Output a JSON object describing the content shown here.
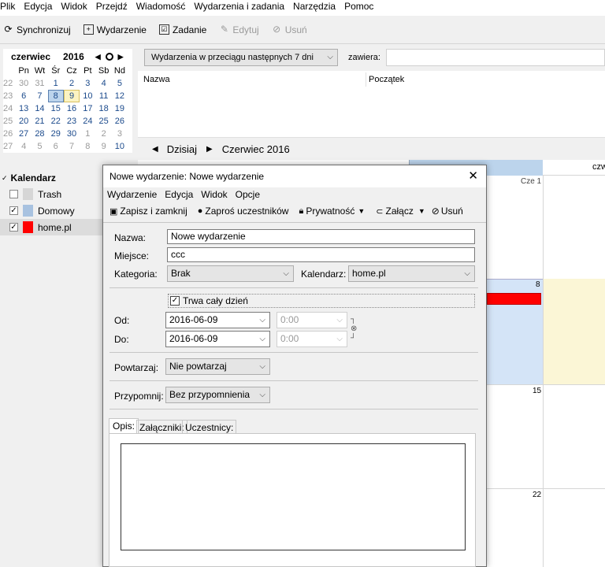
{
  "menubar": {
    "items": [
      "Plik",
      "Edycja",
      "Widok",
      "Przejdź",
      "Wiadomość",
      "Wydarzenia i zadania",
      "Narzędzia",
      "Pomoc"
    ]
  },
  "toolbar": {
    "sync": "Synchronizuj",
    "event": "Wydarzenie",
    "task": "Zadanie",
    "edit": "Edytuj",
    "delete": "Usuń"
  },
  "minical": {
    "month": "czerwiec",
    "year": "2016",
    "daynames": [
      "Pn",
      "Wt",
      "Śr",
      "Cz",
      "Pt",
      "Sb",
      "Nd"
    ],
    "weeks": [
      {
        "wk": "22",
        "days": [
          "30",
          "31",
          "1",
          "2",
          "3",
          "4",
          "5"
        ]
      },
      {
        "wk": "23",
        "days": [
          "6",
          "7",
          "8",
          "9",
          "10",
          "11",
          "12"
        ]
      },
      {
        "wk": "24",
        "days": [
          "13",
          "14",
          "15",
          "16",
          "17",
          "18",
          "19"
        ]
      },
      {
        "wk": "25",
        "days": [
          "20",
          "21",
          "22",
          "23",
          "24",
          "25",
          "26"
        ]
      },
      {
        "wk": "26",
        "days": [
          "27",
          "28",
          "29",
          "30",
          "1",
          "2",
          "3"
        ]
      },
      {
        "wk": "27",
        "days": [
          "4",
          "5",
          "6",
          "7",
          "8",
          "9",
          "10"
        ]
      }
    ]
  },
  "calendars": {
    "header": "Kalendarz",
    "items": [
      {
        "name": "Trash",
        "checked": false,
        "color": "#d6d6d6"
      },
      {
        "name": "Domowy",
        "checked": true,
        "color": "#a8c2e0"
      },
      {
        "name": "home.pl",
        "checked": true,
        "color": "#ff0000"
      }
    ]
  },
  "search": {
    "filter": "Wydarzenia w przeciągu następnych 7 dni",
    "contains_label": "zawiera:",
    "col_name": "Nazwa",
    "col_start": "Początek"
  },
  "nav": {
    "today": "Dzisiaj",
    "period": "Czerwiec 2016"
  },
  "week": {
    "col_label": "czw",
    "cells": {
      "cze1": "Cze 1",
      "d8": "8",
      "d15": "15",
      "d22": "22"
    }
  },
  "dialog": {
    "title": "Nowe wydarzenie: Nowe wydarzenie",
    "menu": [
      "Wydarzenie",
      "Edycja",
      "Widok",
      "Opcje"
    ],
    "toolbar": {
      "save_close": "Zapisz i zamknij",
      "invite": "Zaproś uczestników",
      "privacy": "Prywatność",
      "attach": "Załącz",
      "delete": "Usuń"
    },
    "labels": {
      "name": "Nazwa:",
      "place": "Miejsce:",
      "category": "Kategoria:",
      "calendar": "Kalendarz:",
      "allday": "Trwa cały dzień",
      "from": "Od:",
      "to": "Do:",
      "repeat": "Powtarzaj:",
      "remind": "Przypomnij:"
    },
    "values": {
      "name": "Nowe wydarzenie",
      "place": "ccc",
      "category": "Brak",
      "calendar": "home.pl",
      "from_date": "2016-06-09",
      "from_time": "0:00",
      "to_date": "2016-06-09",
      "to_time": "0:00",
      "repeat": "Nie powtarzaj",
      "remind": "Bez przypomnienia"
    },
    "tabs": [
      "Opis:",
      "Załączniki:",
      "Uczestnicy:"
    ]
  }
}
